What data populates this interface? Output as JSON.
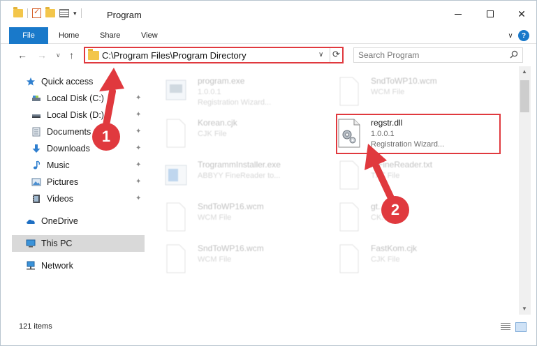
{
  "window": {
    "title": "Program",
    "controls": {
      "minimize": "minimize",
      "maximize": "maximize",
      "close": "✕"
    }
  },
  "ribbon": {
    "tabs": [
      "File",
      "Home",
      "Share",
      "View"
    ],
    "expand": "∨",
    "help": "?"
  },
  "nav": {
    "back": "←",
    "forward": "→",
    "recent": "∨",
    "up": "↑",
    "address": "C:\\Program Files\\Program Directory",
    "address_dropdown": "∨",
    "refresh": "⟳",
    "search_placeholder": "Search Program"
  },
  "sidebar": {
    "items": [
      {
        "label": "Quick access",
        "icon": "star-icon",
        "pinned": false
      },
      {
        "label": "Local Disk (C:)",
        "icon": "drive-icon",
        "pinned": true
      },
      {
        "label": "Local Disk (D:)",
        "icon": "drive-icon",
        "pinned": true
      },
      {
        "label": "Documents",
        "icon": "documents-icon",
        "pinned": true
      },
      {
        "label": "Downloads",
        "icon": "download-icon",
        "pinned": true
      },
      {
        "label": "Music",
        "icon": "music-icon",
        "pinned": true
      },
      {
        "label": "Pictures",
        "icon": "pictures-icon",
        "pinned": true
      },
      {
        "label": "Videos",
        "icon": "videos-icon",
        "pinned": true
      },
      {
        "label": "OneDrive",
        "icon": "cloud-icon",
        "pinned": false
      },
      {
        "label": "This PC",
        "icon": "pc-icon",
        "pinned": false,
        "selected": true
      },
      {
        "label": "Network",
        "icon": "network-icon",
        "pinned": false
      }
    ],
    "pin_glyph": "📌"
  },
  "files": [
    {
      "name": "program.exe",
      "line2": "1.0.0.1",
      "line3": "Registration Wizard...",
      "icon": "exe-icon",
      "faded": true
    },
    {
      "name": "SndToWP10.wcm",
      "line2": "WCM File",
      "line3": "",
      "icon": "file-icon",
      "faded": true
    },
    {
      "name": "Korean.cjk",
      "line2": "CJK File",
      "line3": "",
      "icon": "file-icon",
      "faded": true
    },
    {
      "name": "regstr.dll",
      "line2": "1.0.0.1",
      "line3": "Registration Wizard...",
      "icon": "dll-gear-icon",
      "faded": false
    },
    {
      "name": "TrogrammInstaller.exe",
      "line2": "ABBYY FineReader to...",
      "line3": "",
      "icon": "installer-icon",
      "faded": true
    },
    {
      "name": "...FineReader.txt",
      "line2": "TXT File",
      "line3": "",
      "icon": "file-icon",
      "faded": true
    },
    {
      "name": "SndToWP16.wcm",
      "line2": "WCM File",
      "line3": "",
      "icon": "file-icon",
      "faded": true
    },
    {
      "name": "gt...",
      "line2": "CK...",
      "line3": "",
      "icon": "file-icon",
      "faded": true
    },
    {
      "name": "SndToWP16.wcm",
      "line2": "WCM File",
      "line3": "",
      "icon": "file-icon",
      "faded": true
    },
    {
      "name": "FastKom.cjk",
      "line2": "CJK File",
      "line3": "",
      "icon": "file-icon",
      "faded": true
    }
  ],
  "status": {
    "items_count": "121 items"
  },
  "annotations": {
    "step1": "1",
    "step2": "2",
    "color": "#e0393e"
  }
}
